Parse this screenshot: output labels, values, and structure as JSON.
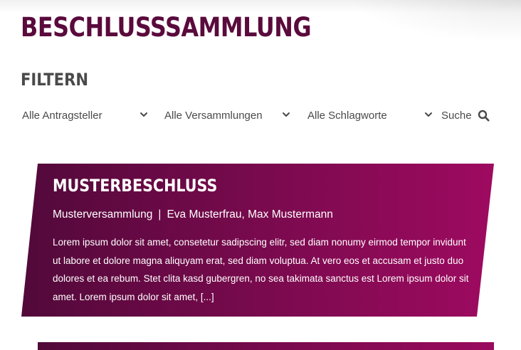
{
  "page": {
    "title": "BESCHLUSSSAMMLUNG"
  },
  "filter": {
    "heading": "FILTERN",
    "selects": [
      {
        "selected": "Alle Antragsteller"
      },
      {
        "selected": "Alle Versammlungen"
      },
      {
        "selected": "Alle Schlagworte"
      }
    ],
    "search_label": "Suche"
  },
  "results": [
    {
      "title": "MUSTERBESCHLUSS",
      "assembly": "Musterversammlung",
      "separator": "|",
      "applicants": "Eva Musterfrau, Max Mustermann",
      "excerpt": "Lorem ipsum dolor sit amet, consetetur sadipscing elitr, sed diam nonumy eirmod tempor invidunt ut labore et dolore magna aliquyam erat, sed diam voluptua. At vero eos et accusam et justo duo dolores et ea rebum. Stet clita kasd gubergren, no sea takimata sanctus est Lorem ipsum dolor sit amet. Lorem ipsum dolor sit amet, [...]"
    }
  ],
  "colors": {
    "brand": "#5a0a3c",
    "card_gradient_start": "#52093a",
    "card_gradient_end": "#9e0a60",
    "text_gray": "#4a4a4a"
  },
  "icons": {
    "select_chevron": "chevron-down-icon",
    "search": "search-icon"
  }
}
